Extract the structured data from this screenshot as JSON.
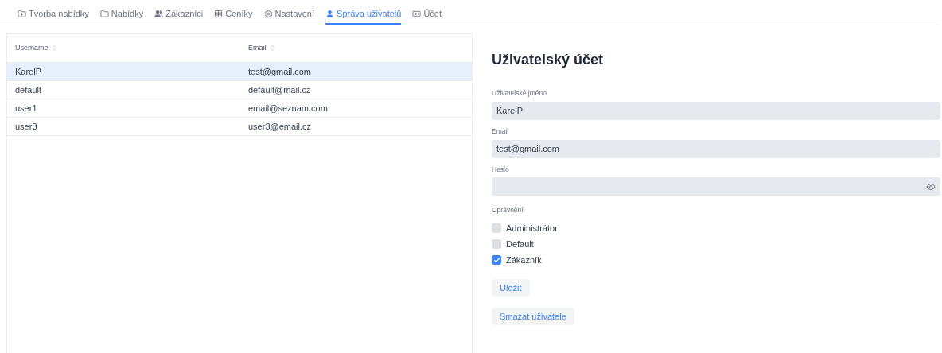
{
  "tabs": [
    {
      "label": "Tvorba nabídky",
      "selected": false
    },
    {
      "label": "Nabídky",
      "selected": false
    },
    {
      "label": "Zákazníci",
      "selected": false
    },
    {
      "label": "Ceníky",
      "selected": false
    },
    {
      "label": "Nastavení",
      "selected": false
    },
    {
      "label": "Správa uživatelů",
      "selected": true
    },
    {
      "label": "Účet",
      "selected": false
    }
  ],
  "table": {
    "columns": [
      "Username",
      "Email"
    ],
    "rows": [
      {
        "cells": [
          "KarelP",
          "test@gmail.com"
        ],
        "selected": true
      },
      {
        "cells": [
          "default",
          "default@mail.cz"
        ],
        "selected": false
      },
      {
        "cells": [
          "user1",
          "email@seznam.com"
        ],
        "selected": false
      },
      {
        "cells": [
          "user3",
          "user3@email.cz"
        ],
        "selected": false
      }
    ]
  },
  "form": {
    "title": "Uživatelský účet",
    "fields": [
      {
        "label": "Uživatelské jméno",
        "value": "KarelP",
        "kind": "text"
      },
      {
        "label": "Email",
        "value": "test@gmail.com",
        "kind": "text"
      },
      {
        "label": "Heslo",
        "kind": "password"
      }
    ],
    "permissions_label": "Oprávnění",
    "permissions": [
      {
        "label": "Administrátor",
        "checked": false
      },
      {
        "label": "Default",
        "checked": false
      },
      {
        "label": "Zákazník",
        "checked": true
      }
    ],
    "buttons": [
      "Uložit",
      "Smazat uživatele"
    ]
  }
}
